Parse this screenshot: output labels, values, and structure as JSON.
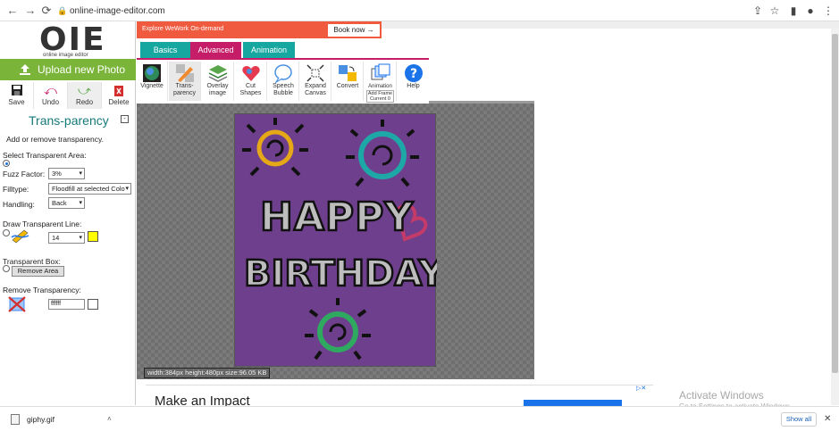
{
  "browser": {
    "url": "online-image-editor.com",
    "back": "←",
    "forward": "→",
    "reload": "⟳"
  },
  "logo": {
    "big": "OIE",
    "small": "online image editor"
  },
  "upload_label": "Upload new Photo",
  "actions": [
    {
      "label": "Save",
      "icon": "floppy-disk-icon"
    },
    {
      "label": "Undo",
      "icon": "undo-arrow-icon"
    },
    {
      "label": "Redo",
      "icon": "redo-arrow-icon"
    },
    {
      "label": "Delete",
      "icon": "trash-icon"
    }
  ],
  "ad_top": {
    "subtitle": "Explore WeWork On-demand",
    "button": "Book now →"
  },
  "tabs": [
    "Basics",
    "Advanced",
    "Animation"
  ],
  "tools": [
    {
      "label": "Vignette",
      "icon": "vignette-icon"
    },
    {
      "label": "Trans-parency",
      "icon": "transparency-icon"
    },
    {
      "label": "Overlay image",
      "icon": "overlay-image-icon"
    },
    {
      "label": "Cut Shapes",
      "icon": "heart-shape-icon"
    },
    {
      "label": "Speech Bubble",
      "icon": "speech-bubble-icon"
    },
    {
      "label": "Expand Canvas",
      "icon": "expand-canvas-icon"
    },
    {
      "label": "Convert",
      "icon": "convert-icon"
    },
    {
      "label": "Animation",
      "sub": "Add Frame Current 0",
      "icon": "animation-frames-icon"
    },
    {
      "label": "Help",
      "icon": "help-icon"
    }
  ],
  "panel": {
    "title": "Trans-parency",
    "collapse": "-",
    "description": "Add or remove transparency.",
    "select_area_label": "Select Transparent Area:",
    "fuzz_label": "Fuzz Factor:",
    "fuzz_value": "3%",
    "filltype_label": "Filltype:",
    "filltype_value": "Floodfill at selected Colo",
    "handling_label": "Handling:",
    "handling_value": "Back",
    "draw_line_label": "Draw Transparent Line:",
    "line_size": "14",
    "line_color": "#ffff00",
    "box_label": "Transparent Box:",
    "remove_area_button": "Remove Area",
    "remove_label": "Remove Transparency:",
    "remove_color": "ffffff"
  },
  "image_info": "width:384px  height:480px  size:96.05 KB",
  "ad_bottom": {
    "headline": "Make an Impact"
  },
  "watermark": {
    "line1": "Activate Windows",
    "line2": "Go to Settings to activate Windows."
  },
  "download": {
    "filename": "giphy.gif",
    "show_all": "Show all"
  },
  "colors": {
    "accent_green": "#7ab539",
    "teal": "#16a8a0",
    "magenta": "#c51d68",
    "image_bg": "#6e3f8c"
  }
}
